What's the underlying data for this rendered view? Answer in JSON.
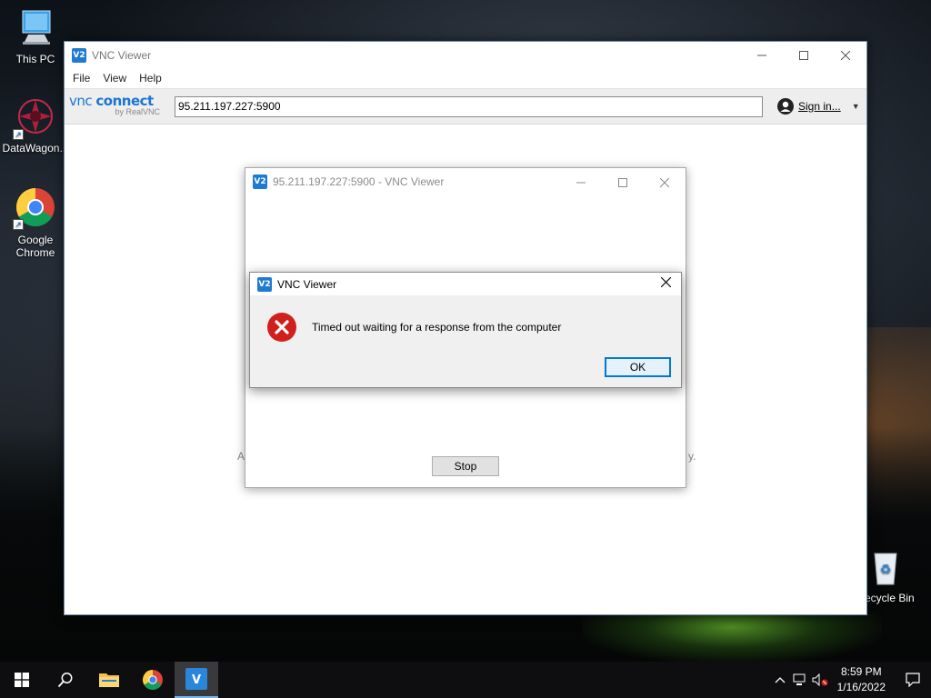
{
  "desktop": {
    "icons": [
      {
        "label": "This PC"
      },
      {
        "label": "DataWagon..."
      },
      {
        "label": "Google Chrome"
      },
      {
        "label": "Recycle Bin"
      }
    ]
  },
  "main_window": {
    "title": "VNC Viewer",
    "app_icon_text": "V2",
    "menu": [
      "File",
      "View",
      "Help"
    ],
    "logo_main_a": "vnc ",
    "logo_main_b": "connect",
    "logo_sub": "by RealVNC",
    "address_value": "95.211.197.227:5900",
    "signin_label": "Sign in...",
    "bg_text_left": "Al",
    "bg_text_right": "y."
  },
  "connection_window": {
    "title": "95.211.197.227:5900 - VNC Viewer",
    "stop_label": "Stop"
  },
  "error_dialog": {
    "title": "VNC Viewer",
    "message": "Timed out waiting for a response from the computer",
    "ok_label": "OK"
  },
  "taskbar": {
    "time": "8:59 PM",
    "date": "1/16/2022"
  },
  "colors": {
    "accent": "#0078d7",
    "vnc_blue": "#1f7ad1",
    "error_red": "#d0201e"
  }
}
